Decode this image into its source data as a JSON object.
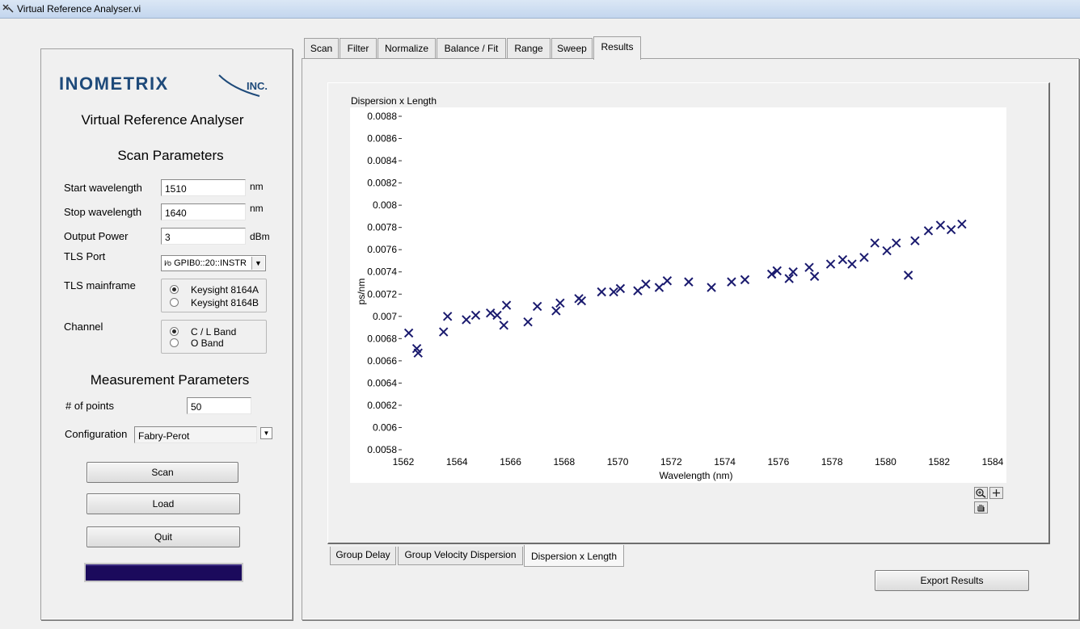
{
  "window": {
    "title": "Virtual Reference Analyser.vi"
  },
  "logo": {
    "main": "INOMETRIX",
    "suffix": "INC."
  },
  "app_title": "Virtual Reference Analyser",
  "scan_parameters": {
    "heading": "Scan Parameters",
    "start_wavelength": {
      "label": "Start wavelength",
      "value": "1510",
      "unit": "nm"
    },
    "stop_wavelength": {
      "label": "Stop wavelength",
      "value": "1640",
      "unit": "nm"
    },
    "output_power": {
      "label": "Output Power",
      "value": "3",
      "unit": "dBm"
    },
    "tls_port": {
      "label": "TLS Port",
      "prefix": "I⁄o",
      "value": "GPIB0::20::INSTR"
    },
    "tls_mainframe": {
      "label": "TLS mainframe",
      "options": [
        "Keysight 8164A",
        "Keysight 8164B"
      ],
      "selected": 0
    },
    "channel": {
      "label": "Channel",
      "options": [
        "C / L Band",
        "O Band"
      ],
      "selected": 0
    }
  },
  "measurement_parameters": {
    "heading": "Measurement Parameters",
    "points": {
      "label": "# of points",
      "value": "50"
    },
    "configuration": {
      "label": "Configuration",
      "value": "Fabry-Perot"
    }
  },
  "buttons": {
    "scan": "Scan",
    "load": "Load",
    "quit": "Quit",
    "export": "Export Results"
  },
  "progress": {
    "value": 1.0,
    "color": "#1b0a5c"
  },
  "tabs": [
    "Scan",
    "Filter",
    "Normalize",
    "Balance / Fit",
    "Range",
    "Sweep",
    "Results"
  ],
  "active_tab": 6,
  "result_tabs": [
    "Group Delay",
    "Group Velocity Dispersion",
    "Dispersion x Length"
  ],
  "active_result_tab": 2,
  "graph": {
    "plot_label": "Dispersion x Length",
    "tools": [
      "zoom-icon",
      "cursor-icon",
      "pan-hand-icon"
    ]
  },
  "chart_data": {
    "type": "scatter",
    "title": "Dispersion x Length",
    "xlabel": "Wavelength (nm)",
    "ylabel": "ps/nm",
    "xlim": [
      1562,
      1584
    ],
    "ylim": [
      0.0058,
      0.0088
    ],
    "x_ticks": [
      "1562",
      "1564",
      "1566",
      "1568",
      "1570",
      "1572",
      "1574",
      "1576",
      "1578",
      "1580",
      "1582",
      "1584"
    ],
    "y_ticks": [
      "0.0058",
      "0.006",
      "0.0062",
      "0.0064",
      "0.0066",
      "0.0068",
      "0.007",
      "0.0072",
      "0.0074",
      "0.0076",
      "0.0078",
      "0.008",
      "0.0082",
      "0.0084",
      "0.0086",
      "0.0088"
    ],
    "marker": "x",
    "color": "#1a1a6e",
    "grid": false,
    "series": [
      {
        "x": [
          1562.2,
          1562.5,
          1562.55,
          1563.5,
          1563.65,
          1564.35,
          1564.7,
          1565.25,
          1565.5,
          1565.75,
          1565.85,
          1566.65,
          1567.0,
          1567.7,
          1567.85,
          1568.55,
          1568.65,
          1569.4,
          1569.85,
          1570.1,
          1570.75,
          1571.05,
          1571.55,
          1571.85,
          1572.65,
          1573.5,
          1574.25,
          1574.75,
          1575.75,
          1575.95,
          1576.4,
          1576.55,
          1577.15,
          1577.35,
          1577.95,
          1578.4,
          1578.75,
          1579.2,
          1579.6,
          1580.05,
          1580.4,
          1580.85,
          1581.1,
          1581.6,
          1582.05,
          1582.45,
          1582.85
        ],
        "y": [
          0.00685,
          0.00671,
          0.00667,
          0.00686,
          0.007,
          0.00697,
          0.00701,
          0.00703,
          0.00701,
          0.00692,
          0.0071,
          0.00695,
          0.00709,
          0.00705,
          0.00712,
          0.00716,
          0.00714,
          0.00722,
          0.00722,
          0.00725,
          0.00723,
          0.00729,
          0.00726,
          0.00732,
          0.00731,
          0.00726,
          0.00731,
          0.00733,
          0.00738,
          0.00741,
          0.00734,
          0.0074,
          0.00744,
          0.00736,
          0.00747,
          0.00751,
          0.00747,
          0.00753,
          0.00766,
          0.00759,
          0.00766,
          0.00737,
          0.00768,
          0.00777,
          0.00782,
          0.00778,
          0.00783
        ]
      }
    ]
  }
}
